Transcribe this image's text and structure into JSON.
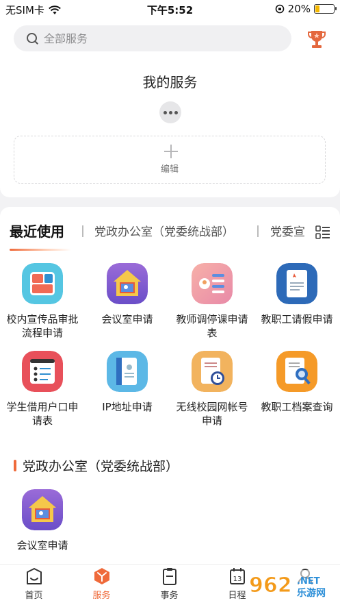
{
  "status_bar": {
    "carrier": "无SIM卡",
    "time": "下午5:52",
    "battery": "20%",
    "battery_level": 0.2
  },
  "search": {
    "placeholder": "全部服务"
  },
  "my_services": {
    "title": "我的服务",
    "edit_label": "编辑"
  },
  "tabs": [
    "最近使用",
    "党政办公室（党委统战部）",
    "党委宣"
  ],
  "recent_services": [
    {
      "label": "校内宣传品审批流程申请",
      "icon": "publicity-icon",
      "color": "#4fc3e0"
    },
    {
      "label": "会议室申请",
      "icon": "meeting-room-icon",
      "color": "#8a6bd8"
    },
    {
      "label": "教师调停课申请表",
      "icon": "schedule-adjust-icon",
      "color": "#f0a0a8"
    },
    {
      "label": "教职工请假申请",
      "icon": "leave-request-icon",
      "color": "#2f6fc0"
    },
    {
      "label": "学生借用户口申请表",
      "icon": "household-register-icon",
      "color": "#e8505a"
    },
    {
      "label": "IP地址申请",
      "icon": "ip-address-icon",
      "color": "#5cb8e6"
    },
    {
      "label": "无线校园网帐号申请",
      "icon": "wireless-account-icon",
      "color": "#f0b060"
    },
    {
      "label": "教职工档案查询",
      "icon": "archive-query-icon",
      "color": "#f59a28"
    }
  ],
  "section": {
    "title": "党政办公室（党委统战部）",
    "services": [
      {
        "label": "会议室申请",
        "icon": "meeting-room-icon",
        "color": "#8a6bd8"
      }
    ]
  },
  "bottom_nav": [
    {
      "label": "首页",
      "icon": "home-icon"
    },
    {
      "label": "服务",
      "icon": "service-icon",
      "active": true
    },
    {
      "label": "事务",
      "icon": "clipboard-icon"
    },
    {
      "label": "日程",
      "icon": "calendar-icon"
    },
    {
      "label": "",
      "icon": "profile-icon"
    }
  ],
  "watermark": "962.NET 乐游网",
  "colors": {
    "accent": "#ef6a3a",
    "background": "#f2f2f4"
  }
}
